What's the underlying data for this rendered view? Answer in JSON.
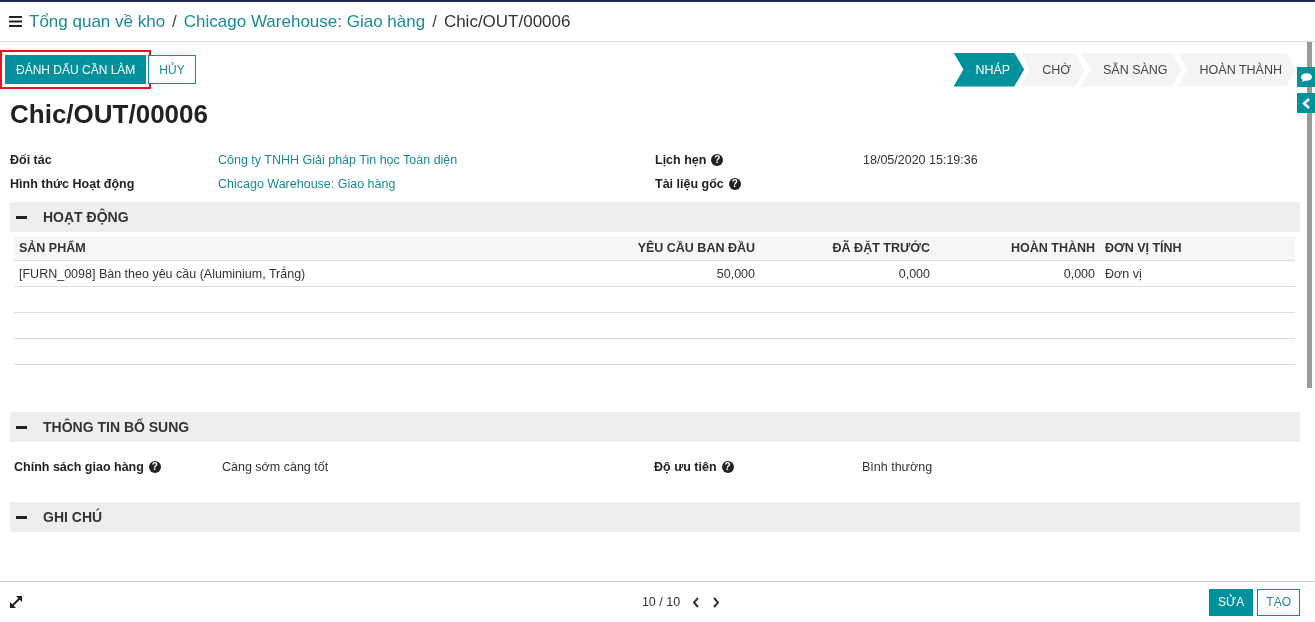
{
  "breadcrumb": [
    {
      "label": "Tổng quan về kho",
      "link": true
    },
    {
      "label": "Chicago Warehouse: Giao hàng",
      "link": true
    },
    {
      "label": "Chic/OUT/00006",
      "link": false
    }
  ],
  "breadcrumb_separators": [
    "/",
    "/"
  ],
  "buttons": [
    {
      "label": "ĐÁNH DẤU CẦN LÀM",
      "kind": "primary",
      "highlighted": true
    },
    {
      "label": "HỦY",
      "kind": "secondary",
      "highlighted": false
    }
  ],
  "stages": [
    {
      "label": "NHÁP",
      "selected": true
    },
    {
      "label": "CHỜ",
      "selected": false
    },
    {
      "label": "SẴN SÀNG",
      "selected": false
    },
    {
      "label": "HOÀN THÀNH",
      "selected": false
    }
  ],
  "title": "Chic/OUT/00006",
  "fields_left": [
    {
      "label": "Đối tác",
      "value": "Công ty TNHH Giải pháp Tin học Toàn diện"
    },
    {
      "label": "Hình thức Hoạt động",
      "value": "Chicago Warehouse: Giao hàng"
    }
  ],
  "fields_right": [
    {
      "label": "Lịch hẹn",
      "value": "18/05/2020 15:19:36",
      "help": "?"
    },
    {
      "label": "Tài liệu gốc",
      "help": "?"
    }
  ],
  "operations": {
    "header": "HOẠT ĐỘNG",
    "columns": [
      "SẢN PHẨM",
      "YÊU CẦU BAN ĐẦU",
      "ĐÃ ĐẶT TRƯỚC",
      "HOÀN THÀNH",
      "ĐƠN VỊ TÍNH"
    ],
    "rows": [
      [
        "[FURN_0098] Bàn theo yêu cầu (Aluminium, Trắng)",
        "50,000",
        "0,000",
        "0,000",
        "Đơn vị"
      ]
    ]
  },
  "extra": {
    "header": "THÔNG TIN BỔ SUNG",
    "fields": [
      {
        "label": "Chính sách giao hàng",
        "value": "Càng sớm càng tốt",
        "help": "?"
      },
      {
        "label": "Độ ưu tiên",
        "value": "Bình thường",
        "help": "?"
      }
    ]
  },
  "notes": {
    "header": "GHI CHÚ"
  },
  "pager": "10 / 10",
  "footer_buttons": [
    {
      "label": "SỬA",
      "kind": "primary"
    },
    {
      "label": "TẠO",
      "kind": "secondary"
    }
  ]
}
